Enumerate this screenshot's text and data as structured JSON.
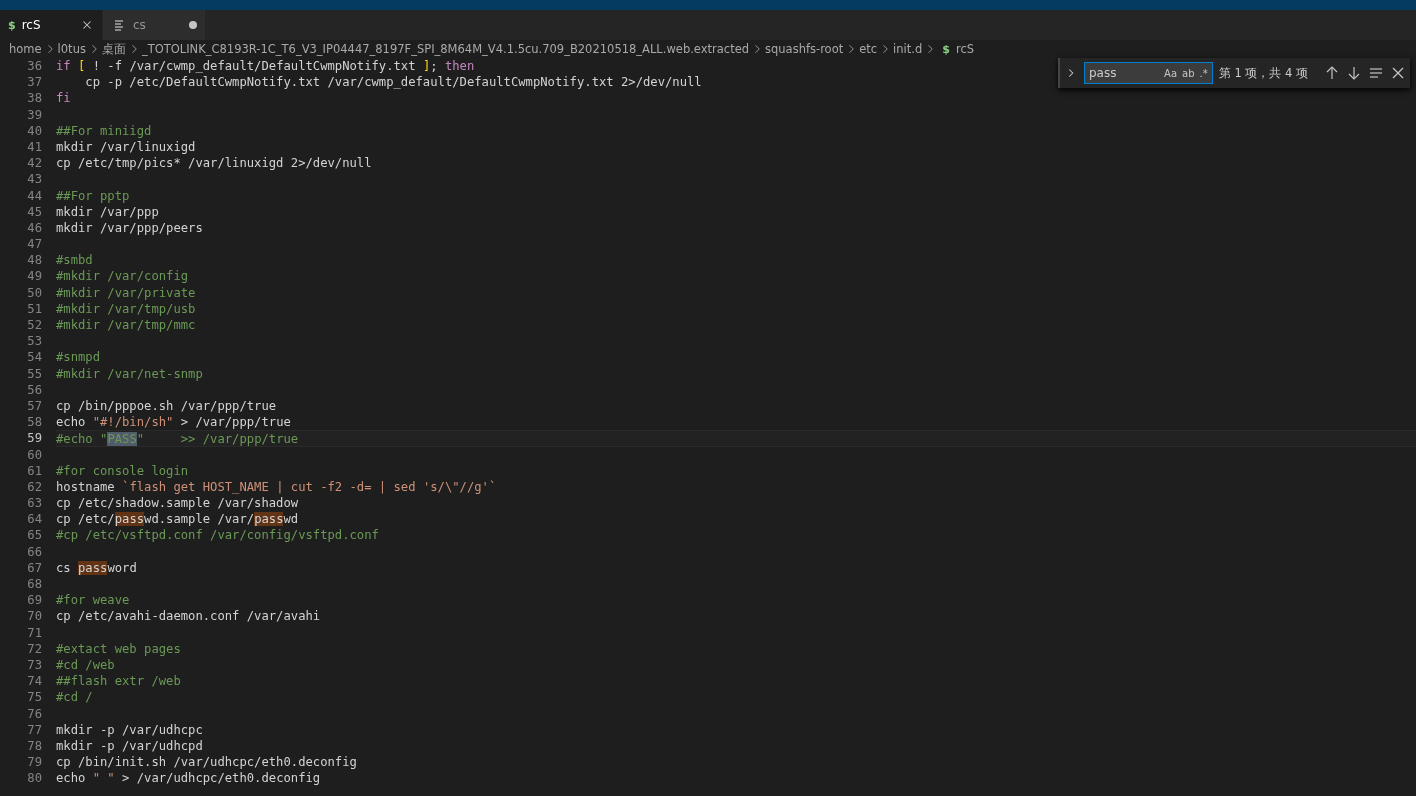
{
  "tabs": [
    {
      "label": "rcS",
      "kind": "shell",
      "icon": "$",
      "selected": true,
      "dirty": false
    },
    {
      "label": "cs",
      "kind": "text",
      "selected": false,
      "dirty": true
    }
  ],
  "breadcrumb": [
    {
      "label": "home"
    },
    {
      "label": "l0tus"
    },
    {
      "label": "桌面"
    },
    {
      "label": "_TOTOLINK_C8193R-1C_T6_V3_IP04447_8197F_SPI_8M64M_V4.1.5cu.709_B20210518_ALL.web.extracted"
    },
    {
      "label": "squashfs-root"
    },
    {
      "label": "etc"
    },
    {
      "label": "init.d"
    },
    {
      "label": "rcS",
      "icon": "$"
    }
  ],
  "find_widget": {
    "value": "pass",
    "toggles": [
      "Aa",
      "ab",
      ".*"
    ],
    "result": "第 1 项，共 4 项"
  },
  "lines": [
    {
      "number": "36",
      "current": false,
      "tokens": [
        {
          "kind": "keyword",
          "text": "if "
        },
        {
          "kind": "bracket",
          "text": "["
        },
        {
          "kind": "plain",
          "text": " ! -f /var/cwmp_default/DefaultCwmpNotify.txt "
        },
        {
          "kind": "bracket",
          "text": "]"
        },
        {
          "kind": "plain",
          "text": "; "
        },
        {
          "kind": "keyword",
          "text": "then"
        }
      ]
    },
    {
      "number": "37",
      "current": false,
      "tokens": [
        {
          "kind": "plain",
          "text": "    cp -p /etc/DefaultCwmpNotify.txt /var/cwmp_default/DefaultCwmpNotify.txt 2>/dev/null"
        }
      ]
    },
    {
      "number": "38",
      "current": false,
      "tokens": [
        {
          "kind": "keyword",
          "text": "fi"
        }
      ]
    },
    {
      "number": "39",
      "current": false
    },
    {
      "number": "40",
      "current": false,
      "tokens": [
        {
          "kind": "comment",
          "text": "##For miniigd"
        }
      ]
    },
    {
      "number": "41",
      "current": false,
      "tokens": [
        {
          "kind": "plain",
          "text": "mkdir /var/linuxigd"
        }
      ]
    },
    {
      "number": "42",
      "current": false,
      "tokens": [
        {
          "kind": "plain",
          "text": "cp /etc/tmp/pics* /var/linuxigd 2>/dev/null"
        }
      ]
    },
    {
      "number": "43",
      "current": false
    },
    {
      "number": "44",
      "current": false,
      "tokens": [
        {
          "kind": "comment",
          "text": "##For pptp"
        }
      ]
    },
    {
      "number": "45",
      "current": false,
      "tokens": [
        {
          "kind": "plain",
          "text": "mkdir /var/ppp"
        }
      ]
    },
    {
      "number": "46",
      "current": false,
      "tokens": [
        {
          "kind": "plain",
          "text": "mkdir /var/ppp/peers"
        }
      ]
    },
    {
      "number": "47",
      "current": false
    },
    {
      "number": "48",
      "current": false,
      "tokens": [
        {
          "kind": "comment",
          "text": "#smbd"
        }
      ]
    },
    {
      "number": "49",
      "current": false,
      "tokens": [
        {
          "kind": "comment",
          "text": "#mkdir /var/config"
        }
      ]
    },
    {
      "number": "50",
      "current": false,
      "tokens": [
        {
          "kind": "comment",
          "text": "#mkdir /var/private"
        }
      ]
    },
    {
      "number": "51",
      "current": false,
      "tokens": [
        {
          "kind": "comment",
          "text": "#mkdir /var/tmp/usb"
        }
      ]
    },
    {
      "number": "52",
      "current": false,
      "tokens": [
        {
          "kind": "comment",
          "text": "#mkdir /var/tmp/mmc"
        }
      ]
    },
    {
      "number": "53",
      "current": false
    },
    {
      "number": "54",
      "current": false,
      "tokens": [
        {
          "kind": "comment",
          "text": "#snmpd"
        }
      ]
    },
    {
      "number": "55",
      "current": false,
      "tokens": [
        {
          "kind": "comment",
          "text": "#mkdir /var/net-snmp"
        }
      ]
    },
    {
      "number": "56",
      "current": false
    },
    {
      "number": "57",
      "current": false,
      "tokens": [
        {
          "kind": "plain",
          "text": "cp /bin/pppoe.sh /var/ppp/true"
        }
      ]
    },
    {
      "number": "58",
      "current": false,
      "tokens": [
        {
          "kind": "plain",
          "text": "echo "
        },
        {
          "kind": "string",
          "text": "\"#!/bin/sh\""
        },
        {
          "kind": "plain",
          "text": " > /var/ppp/true"
        }
      ]
    },
    {
      "number": "59",
      "current": true,
      "tokens": [
        {
          "kind": "comment",
          "text": "#echo \""
        },
        {
          "kind": "comment",
          "text": "PASS",
          "match": true,
          "selected": true
        },
        {
          "kind": "comment",
          "text": "\"     >> /var/ppp/true"
        }
      ]
    },
    {
      "number": "60",
      "current": false
    },
    {
      "number": "61",
      "current": false,
      "tokens": [
        {
          "kind": "comment",
          "text": "#for console login"
        }
      ]
    },
    {
      "number": "62",
      "current": false,
      "tokens": [
        {
          "kind": "plain",
          "text": "hostname "
        },
        {
          "kind": "string",
          "text": "`flash get HOST_NAME | cut -f2 -d= | sed 's/\\\"//g'`"
        }
      ]
    },
    {
      "number": "63",
      "current": false,
      "tokens": [
        {
          "kind": "plain",
          "text": "cp /etc/shadow.sample /var/shadow"
        }
      ]
    },
    {
      "number": "64",
      "current": false,
      "tokens": [
        {
          "kind": "plain",
          "text": "cp /etc/"
        },
        {
          "kind": "plain",
          "text": "pass",
          "match": true,
          "selected": false
        },
        {
          "kind": "plain",
          "text": "wd.sample /var/"
        },
        {
          "kind": "plain",
          "text": "pass",
          "match": true,
          "selected": false
        },
        {
          "kind": "plain",
          "text": "wd"
        }
      ]
    },
    {
      "number": "65",
      "current": false,
      "tokens": [
        {
          "kind": "comment",
          "text": "#cp /etc/vsftpd.conf /var/config/vsftpd.conf"
        }
      ]
    },
    {
      "number": "66",
      "current": false
    },
    {
      "number": "67",
      "current": false,
      "tokens": [
        {
          "kind": "plain",
          "text": "cs "
        },
        {
          "kind": "plain",
          "text": "pass",
          "match": true,
          "selected": false
        },
        {
          "kind": "plain",
          "text": "word"
        }
      ]
    },
    {
      "number": "68",
      "current": false
    },
    {
      "number": "69",
      "current": false,
      "tokens": [
        {
          "kind": "comment",
          "text": "#for weave"
        }
      ]
    },
    {
      "number": "70",
      "current": false,
      "tokens": [
        {
          "kind": "plain",
          "text": "cp /etc/avahi-daemon.conf /var/avahi"
        }
      ]
    },
    {
      "number": "71",
      "current": false
    },
    {
      "number": "72",
      "current": false,
      "tokens": [
        {
          "kind": "comment",
          "text": "#extact web pages"
        }
      ]
    },
    {
      "number": "73",
      "current": false,
      "tokens": [
        {
          "kind": "comment",
          "text": "#cd /web"
        }
      ]
    },
    {
      "number": "74",
      "current": false,
      "tokens": [
        {
          "kind": "comment",
          "text": "##flash extr /web"
        }
      ]
    },
    {
      "number": "75",
      "current": false,
      "tokens": [
        {
          "kind": "comment",
          "text": "#cd /"
        }
      ]
    },
    {
      "number": "76",
      "current": false
    },
    {
      "number": "77",
      "current": false,
      "tokens": [
        {
          "kind": "plain",
          "text": "mkdir -p /var/udhcpc"
        }
      ]
    },
    {
      "number": "78",
      "current": false,
      "tokens": [
        {
          "kind": "plain",
          "text": "mkdir -p /var/udhcpd"
        }
      ]
    },
    {
      "number": "79",
      "current": false,
      "tokens": [
        {
          "kind": "plain",
          "text": "cp /bin/init.sh /var/udhcpc/eth0.deconfig"
        }
      ]
    },
    {
      "number": "80",
      "current": false,
      "tokens": [
        {
          "kind": "plain",
          "text": "echo "
        },
        {
          "kind": "string",
          "text": "\" \""
        },
        {
          "kind": "plain",
          "text": " > /var/udhcpc/eth0.deconfig"
        }
      ]
    }
  ]
}
